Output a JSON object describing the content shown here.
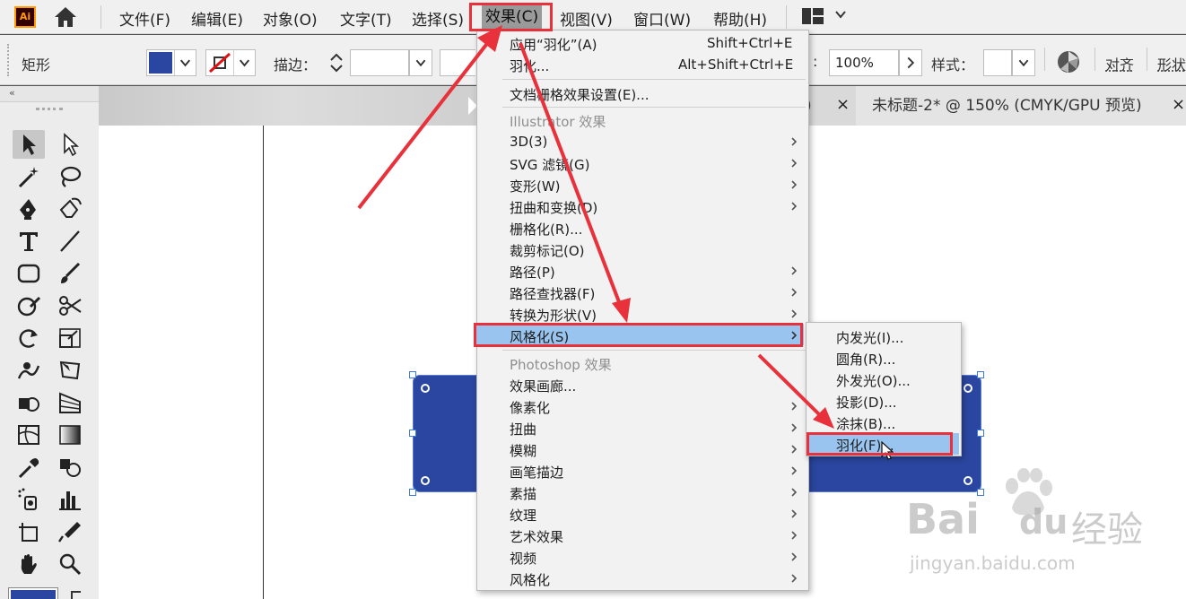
{
  "app": {
    "logo": "Ai"
  },
  "menubar": {
    "items": [
      "文件(F)",
      "编辑(E)",
      "对象(O)",
      "文字(T)",
      "选择(S)",
      "效果(C)",
      "视图(V)",
      "窗口(W)",
      "帮助(H)"
    ],
    "active": "效果(C)"
  },
  "controlbar": {
    "shape_label": "矩形",
    "stroke_label": "描边：",
    "opacity_value": "100%",
    "style_label": "样式：",
    "align_link": "对齐",
    "shape_link": "形状",
    "fill_color": "#2b46a0"
  },
  "tabs": [
    {
      "label": ")",
      "close": "×"
    },
    {
      "label": "未标题-2* @ 150% (CMYK/GPU 预览)",
      "close": "×"
    }
  ],
  "toolbar": {
    "collapse_glyph": "«"
  },
  "effect_menu": {
    "items": [
      {
        "label": "应用“羽化”(A)",
        "shortcut": "Shift+Ctrl+E"
      },
      {
        "label": "羽化...",
        "shortcut": "Alt+Shift+Ctrl+E"
      },
      {
        "label": "文档栅格效果设置(E)..."
      },
      {
        "label": "Illustrator 效果",
        "disabled": true
      },
      {
        "label": "3D(3)",
        "submenu": true
      },
      {
        "label": "SVG 滤镜(G)",
        "submenu": true
      },
      {
        "label": "变形(W)",
        "submenu": true
      },
      {
        "label": "扭曲和变换(D)",
        "submenu": true
      },
      {
        "label": "栅格化(R)..."
      },
      {
        "label": "裁剪标记(O)"
      },
      {
        "label": "路径(P)",
        "submenu": true
      },
      {
        "label": "路径查找器(F)",
        "submenu": true
      },
      {
        "label": "转换为形状(V)",
        "submenu": true
      },
      {
        "label": "风格化(S)",
        "submenu": true,
        "highlighted": true
      },
      {
        "label": "Photoshop 效果",
        "disabled": true
      },
      {
        "label": "效果画廊..."
      },
      {
        "label": "像素化",
        "submenu": true
      },
      {
        "label": "扭曲",
        "submenu": true
      },
      {
        "label": "模糊",
        "submenu": true
      },
      {
        "label": "画笔描边",
        "submenu": true
      },
      {
        "label": "素描",
        "submenu": true
      },
      {
        "label": "纹理",
        "submenu": true
      },
      {
        "label": "艺术效果",
        "submenu": true
      },
      {
        "label": "视频",
        "submenu": true
      },
      {
        "label": "风格化",
        "submenu": true
      }
    ]
  },
  "stylize_submenu": {
    "items": [
      "内发光(I)...",
      "圆角(R)...",
      "外发光(O)...",
      "投影(D)...",
      "涂抹(B)...",
      "羽化(F)..."
    ],
    "highlighted": "羽化(F)..."
  },
  "watermark": {
    "brand": "Bai",
    "brand_tail": "du",
    "cn": "经验",
    "url": "jingyan.baidu.com"
  },
  "colors": {
    "highlight": "#99c4f0",
    "annotation_red": "#e8313a",
    "shape_blue": "#2b46a0"
  }
}
